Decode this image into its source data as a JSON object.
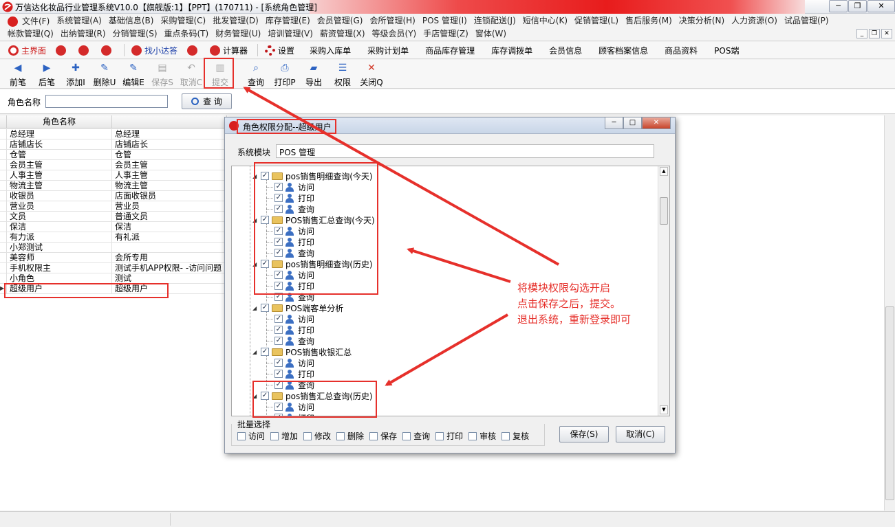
{
  "window": {
    "title": "万信达化妆品行业管理系统V10.0【旗舰版:1】【PPT】(170711) - [系统角色管理]",
    "controls": [
      "─",
      "❐",
      "✕"
    ]
  },
  "menu": {
    "row1": [
      "文件(F)",
      "系统管理(A)",
      "基础信息(B)",
      "采购管理(C)",
      "批发管理(D)",
      "库存管理(E)",
      "会员管理(G)",
      "会所管理(H)",
      "POS 管理(I)",
      "连锁配送(J)",
      "短信中心(K)",
      "促销管理(L)",
      "售后服务(M)",
      "决策分析(N)",
      "人力资源(O)",
      "试品管理(P)"
    ],
    "row2": [
      "帐款管理(Q)",
      "出纳管理(R)",
      "分销管理(S)",
      "重点条码(T)",
      "财务管理(U)",
      "培训管理(V)",
      "薪资管理(X)",
      "等级会员(Y)",
      "手店管理(Z)",
      "窗体(W)"
    ],
    "mdi_controls": [
      "_",
      "❐",
      "✕"
    ]
  },
  "quickbar": {
    "home": "主界面",
    "find": "找小达答",
    "calculator": "计算器",
    "settings": "设置",
    "links": [
      "采购入库单",
      "采购计划单",
      "商品库存管理",
      "库存调拨单",
      "会员信息",
      "顾客档案信息",
      "商品资料",
      "POS端"
    ]
  },
  "toolbar": {
    "buttons": [
      {
        "label": "前笔",
        "icon": "◀",
        "disabled": false
      },
      {
        "label": "后笔",
        "icon": "▶",
        "disabled": false
      },
      {
        "label": "添加I",
        "icon": "✚",
        "disabled": false
      },
      {
        "label": "删除U",
        "icon": "✎",
        "disabled": false
      },
      {
        "label": "编辑E",
        "icon": "✎",
        "disabled": false
      },
      {
        "label": "保存S",
        "icon": "▤",
        "disabled": true
      },
      {
        "label": "取消C",
        "icon": "↶",
        "disabled": true
      },
      {
        "label": "提交",
        "icon": "▥",
        "disabled": true
      },
      {
        "label": "查询",
        "icon": "⌕",
        "disabled": false
      },
      {
        "label": "打印P",
        "icon": "⎙",
        "disabled": false
      },
      {
        "label": "导出",
        "icon": "▰",
        "disabled": false
      },
      {
        "label": "权限",
        "icon": "☰",
        "disabled": false
      },
      {
        "label": "关闭Q",
        "icon": "✕",
        "disabled": false
      }
    ]
  },
  "search": {
    "label": "角色名称",
    "value": "",
    "button": "查 询"
  },
  "grid": {
    "header": "角色名称",
    "rows": [
      [
        "总经理",
        "总经理"
      ],
      [
        "店铺店长",
        "店铺店长"
      ],
      [
        "仓管",
        "仓管"
      ],
      [
        "会员主管",
        "会员主管"
      ],
      [
        "人事主管",
        "人事主管"
      ],
      [
        "物流主管",
        "物流主管"
      ],
      [
        "收银员",
        "店面收银员"
      ],
      [
        "营业员",
        "营业员"
      ],
      [
        "文员",
        "普通文员"
      ],
      [
        "保洁",
        "保洁"
      ],
      [
        "有力派",
        "有礼派"
      ],
      [
        "小郑测试",
        ""
      ],
      [
        "美容师",
        "会所专用"
      ],
      [
        "手机权限主",
        "测试手机APP权限- -访问问题"
      ],
      [
        "小角色",
        "测试"
      ],
      [
        "超级用户",
        "超级用户"
      ]
    ],
    "current_row_marker": "▶"
  },
  "dialog": {
    "title": "角色权限分配--超级用户",
    "controls": [
      "─",
      "□",
      "✕"
    ],
    "module_label": "系统模块",
    "module_value": "POS 管理",
    "tree": [
      {
        "kind": "group",
        "label": "pos销售明细查询(今天)"
      },
      {
        "kind": "perm",
        "label": "访问"
      },
      {
        "kind": "perm",
        "label": "打印"
      },
      {
        "kind": "perm",
        "label": "查询"
      },
      {
        "kind": "group",
        "label": "POS销售汇总查询(今天)"
      },
      {
        "kind": "perm",
        "label": "访问"
      },
      {
        "kind": "perm",
        "label": "打印"
      },
      {
        "kind": "perm",
        "label": "查询"
      },
      {
        "kind": "group",
        "label": "pos销售明细查询(历史)"
      },
      {
        "kind": "perm",
        "label": "访问"
      },
      {
        "kind": "perm",
        "label": "打印"
      },
      {
        "kind": "perm",
        "label": "查询"
      },
      {
        "kind": "group",
        "label": "POS端客单分析"
      },
      {
        "kind": "perm",
        "label": "访问"
      },
      {
        "kind": "perm",
        "label": "打印"
      },
      {
        "kind": "perm",
        "label": "查询"
      },
      {
        "kind": "group",
        "label": "POS销售收银汇总"
      },
      {
        "kind": "perm",
        "label": "访问"
      },
      {
        "kind": "perm",
        "label": "打印"
      },
      {
        "kind": "perm",
        "label": "查询"
      },
      {
        "kind": "group",
        "label": "pos销售汇总查询(历史)"
      },
      {
        "kind": "perm",
        "label": "访问"
      },
      {
        "kind": "perm",
        "label": "打印"
      }
    ],
    "checkmark": "✓",
    "batch_label": "批量选择",
    "batch_items": [
      "访问",
      "增加",
      "修改",
      "删除",
      "保存",
      "查询",
      "打印",
      "审核",
      "复核"
    ],
    "save_button": "保存(S)",
    "cancel_button": "取消(C)"
  },
  "annotation": {
    "lines": [
      "将模块权限勾选开启",
      "点击保存之后，提交。",
      "退出系统，重新登录即可"
    ],
    "color": "#e6302b"
  }
}
